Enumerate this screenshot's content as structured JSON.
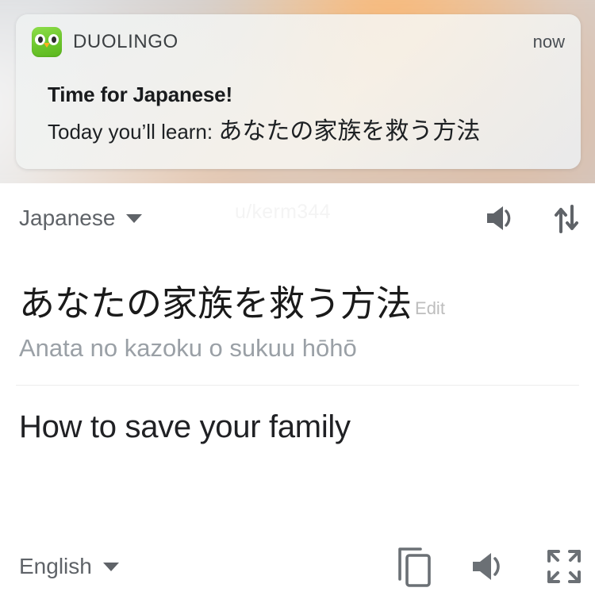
{
  "notification": {
    "app_name": "DUOLINGO",
    "time": "now",
    "title": "Time for Japanese!",
    "body_prefix": "Today you’ll learn: ",
    "body_japanese": "あなたの家族を救う方法",
    "icon": "duolingo-owl-icon"
  },
  "app": {
    "watermark": "u/kerm344",
    "source_language": "Japanese",
    "target_language": "English",
    "source_text": "あなたの家族を救う方法",
    "edit_label": "Edit",
    "romaji": "Anata no kazoku o sukuu hōhō",
    "translation": "How to save your family",
    "top_actions": [
      {
        "name": "listen-source-icon",
        "label": "Listen"
      },
      {
        "name": "swap-languages-icon",
        "label": "Swap languages"
      }
    ],
    "bottom_actions": [
      {
        "name": "copy-icon",
        "label": "Copy"
      },
      {
        "name": "listen-translation-icon",
        "label": "Listen"
      },
      {
        "name": "fullscreen-icon",
        "label": "Fullscreen"
      }
    ]
  },
  "colors": {
    "text_primary": "#202124",
    "text_secondary": "#5f6368",
    "text_muted": "#9aa0a6",
    "edit_gray": "#bdbdbd",
    "divider": "#ececec",
    "icon_gray": "#5f6368",
    "duolingo_green": "#6cc62c",
    "duolingo_beak": "#ffb020",
    "watermark": "#f4f4f4",
    "app_background": "#ffffff"
  }
}
